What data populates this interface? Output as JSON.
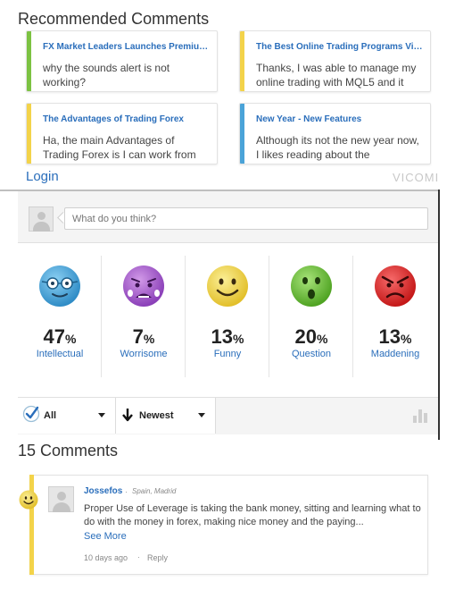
{
  "recommended": {
    "title": "Recommended Comments",
    "cards": [
      {
        "title": "FX Market Leaders Launches Premium...",
        "body": "why the sounds alert is not working?",
        "color": "#7cc242"
      },
      {
        "title": "The Best Online Trading Programs Via ...",
        "body": "Thanks, I was able to manage my online trading with MQL5 and it",
        "color": "#f3d34a"
      },
      {
        "title": "The Advantages of Trading Forex",
        "body": "Ha, the main Advantages of Trading Forex is I can work from",
        "color": "#f3d34a"
      },
      {
        "title": "New Year - New Features",
        "body": "Although its not the new year now, I likes reading about the",
        "color": "#4aa3d8"
      }
    ]
  },
  "header": {
    "login": "Login",
    "brand": "VICOMI"
  },
  "composer": {
    "placeholder": "What do you think?"
  },
  "reactions": [
    {
      "percent": "47",
      "symbol": "%",
      "label": "Intellectual",
      "icon": "intellectual-face-icon",
      "color": "#4aa3d8"
    },
    {
      "percent": "7",
      "symbol": "%",
      "label": "Worrisome",
      "icon": "worrisome-face-icon",
      "color": "#9b59c6"
    },
    {
      "percent": "13",
      "symbol": "%",
      "label": "Funny",
      "icon": "funny-face-icon",
      "color": "#f0d54a"
    },
    {
      "percent": "20",
      "symbol": "%",
      "label": "Question",
      "icon": "question-face-icon",
      "color": "#6cc13a"
    },
    {
      "percent": "13",
      "symbol": "%",
      "label": "Maddening",
      "icon": "maddening-face-icon",
      "color": "#e03030"
    }
  ],
  "filters": {
    "all": "All",
    "sort": "Newest"
  },
  "comments": {
    "count_label": "15 Comments",
    "items": [
      {
        "author": "Jossefos",
        "location": "Spain, Madrid",
        "text": "Proper Use of Leverage is taking the bank money, sitting and learning what to do with the money in forex, making nice money and the paying...",
        "see_more": "See More",
        "time": "10 days ago",
        "reply": "Reply"
      }
    ]
  }
}
